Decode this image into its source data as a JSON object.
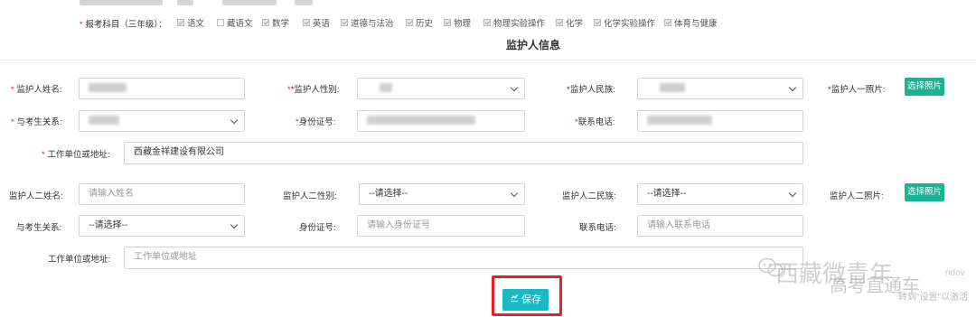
{
  "subjects": {
    "label": "报考科目（三年级）：",
    "items": [
      {
        "name": "语文",
        "checked": true
      },
      {
        "name": "藏语文",
        "checked": false
      },
      {
        "name": "数学",
        "checked": true
      },
      {
        "name": "英语",
        "checked": true
      },
      {
        "name": "道德与法治",
        "checked": true
      },
      {
        "name": "历史",
        "checked": true
      },
      {
        "name": "物理",
        "checked": true
      },
      {
        "name": "物理实验操作",
        "checked": true
      },
      {
        "name": "化学",
        "checked": true
      },
      {
        "name": "化学实验操作",
        "checked": true
      },
      {
        "name": "体育与健康",
        "checked": true
      }
    ]
  },
  "section_title": "监护人信息",
  "guardian1": {
    "name_label": "监护人姓名:",
    "gender_label": "*监护人性别:",
    "ethnicity_label": "*监护人民族:",
    "photo_label": "*监护人一照片:",
    "photo_button": "选择照片",
    "relation_label": "与考生关系:",
    "id_label": "身份证号:",
    "phone_label": "联系电话:",
    "work_label": "工作单位或地址:",
    "work_value": "西藏金祥建设有限公司"
  },
  "guardian2": {
    "name_label": "监护人二姓名:",
    "name_placeholder": "请输入姓名",
    "gender_label": "监护人二性别:",
    "gender_value": "--请选择--",
    "ethnicity_label": "监护人二民族:",
    "ethnicity_value": "--请选择--",
    "photo_label": "监护人二照片:",
    "photo_button": "选择照片",
    "relation_label": "与考生关系:",
    "relation_value": "--请选择--",
    "id_label": "身份证号:",
    "id_placeholder": "请输入身份证号",
    "phone_label": "联系电话:",
    "phone_placeholder": "请输入联系电话",
    "work_label": "工作单位或地址:",
    "work_placeholder": "工作单位或地址"
  },
  "save_label": "保存",
  "watermark": {
    "account": "西藏微青年",
    "overlay": "高考直通车",
    "activate_hint": "转到\"设置\"以激活",
    "activate_word": "ndov"
  },
  "colors": {
    "accent_green": "#1bb394",
    "save_button": "#1bb8c8",
    "highlight_red": "#e52222",
    "required_star": "#e02020"
  }
}
